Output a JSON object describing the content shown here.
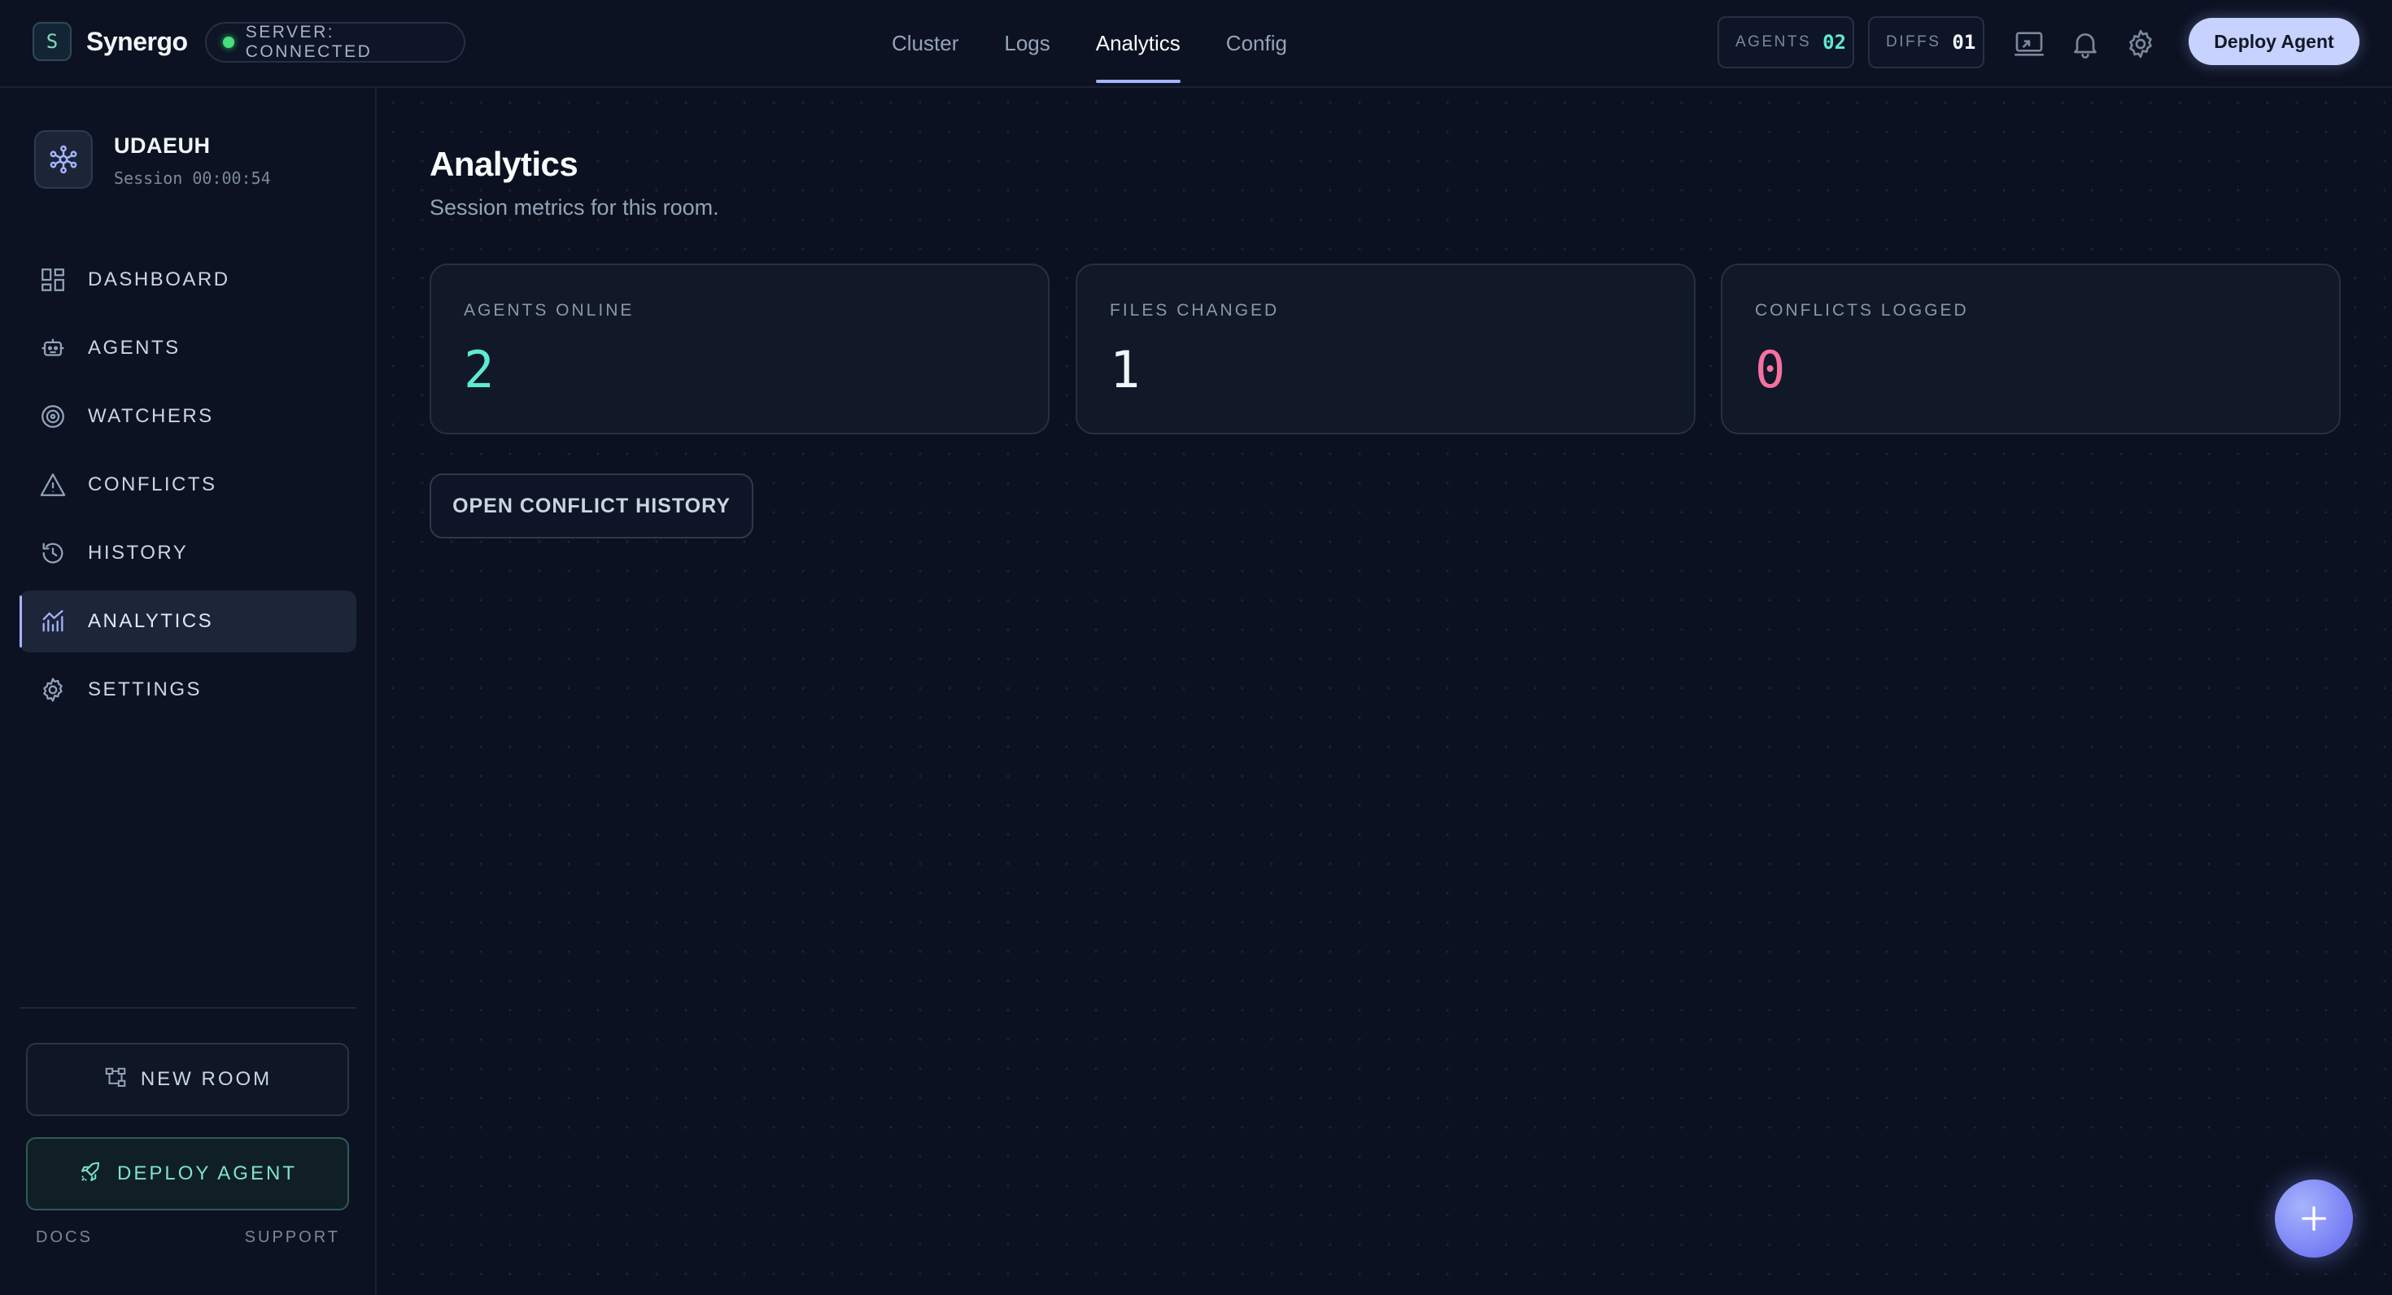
{
  "app": {
    "name": "Synergo",
    "logo_letter": "S"
  },
  "server": {
    "status_text": "SERVER: CONNECTED",
    "status_color": "#4ade80"
  },
  "nav": {
    "items": [
      {
        "label": "Cluster",
        "active": false
      },
      {
        "label": "Logs",
        "active": false
      },
      {
        "label": "Analytics",
        "active": true
      },
      {
        "label": "Config",
        "active": false
      }
    ]
  },
  "counters": {
    "agents": {
      "label": "AGENTS",
      "value": "02"
    },
    "diffs": {
      "label": "DIFFS",
      "value": "01"
    }
  },
  "top_icons": [
    "screen-share-icon",
    "bell-icon",
    "gear-icon"
  ],
  "deploy_button_label": "Deploy Agent",
  "room": {
    "name": "UDAEUH",
    "session": "Session 00:00:54"
  },
  "sidebar": {
    "items": [
      {
        "label": "DASHBOARD",
        "icon": "dashboard-icon",
        "active": false
      },
      {
        "label": "AGENTS",
        "icon": "robot-icon",
        "active": false
      },
      {
        "label": "WATCHERS",
        "icon": "target-icon",
        "active": false
      },
      {
        "label": "CONFLICTS",
        "icon": "warning-icon",
        "active": false
      },
      {
        "label": "HISTORY",
        "icon": "history-icon",
        "active": false
      },
      {
        "label": "ANALYTICS",
        "icon": "analytics-icon",
        "active": true
      },
      {
        "label": "SETTINGS",
        "icon": "gear-icon",
        "active": false
      }
    ],
    "new_room_label": "NEW ROOM",
    "deploy_agent_label": "DEPLOY AGENT",
    "footer": {
      "docs": "DOCS",
      "support": "SUPPORT"
    }
  },
  "page": {
    "title": "Analytics",
    "subtitle": "Session metrics for this room.",
    "cards": [
      {
        "label": "AGENTS ONLINE",
        "value": "2",
        "color": "#5eead4"
      },
      {
        "label": "FILES CHANGED",
        "value": "1",
        "color": "#f1f5f9"
      },
      {
        "label": "CONFLICTS LOGGED",
        "value": "0",
        "color": "#f472a0"
      }
    ],
    "history_button_label": "OPEN CONFLICT HISTORY"
  },
  "colors": {
    "accent": "#a5b4fc",
    "teal": "#5eead4",
    "background": "#0b1120"
  }
}
